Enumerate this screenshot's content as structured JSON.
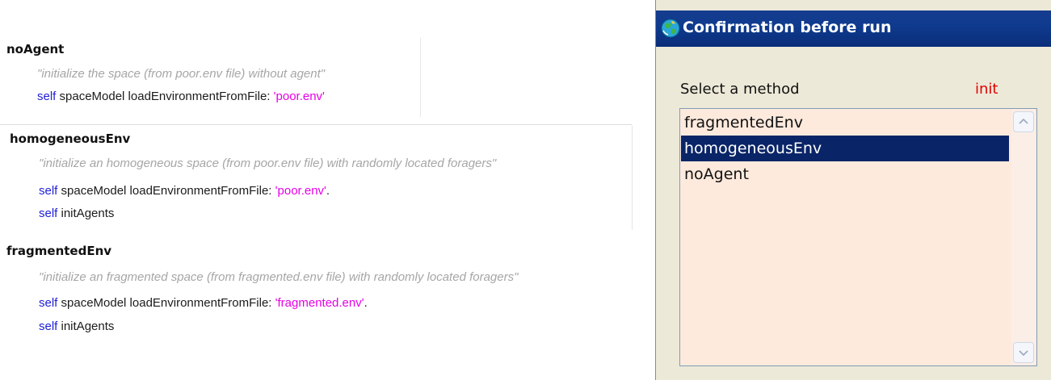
{
  "code_methods": [
    {
      "name": "noAgent",
      "comment": "\"initialize the space (from poor.env file) without agent\"",
      "line1": {
        "kw": "self",
        "text": " spaceModel loadEnvironmentFromFile: ",
        "str": "'poor.env'",
        "tail": ""
      }
    },
    {
      "name": "homogeneousEnv",
      "comment": "\"initialize an homogeneous space (from poor.env file) with randomly located foragers\"",
      "line1": {
        "kw": "self",
        "text": " spaceModel loadEnvironmentFromFile: ",
        "str": "'poor.env'",
        "tail": "."
      },
      "line2": {
        "kw": "self",
        "text": " initAgents"
      }
    },
    {
      "name": "fragmentedEnv",
      "comment": "\"initialize an fragmented space (from fragmented.env file) with randomly located foragers\"",
      "line1": {
        "kw": "self",
        "text": " spaceModel loadEnvironmentFromFile: ",
        "str": "'fragmented.env'",
        "tail": "."
      },
      "line2": {
        "kw": "self",
        "text": " initAgents"
      }
    }
  ],
  "dialog": {
    "title": "Confirmation before run",
    "select_label": "Select a method",
    "init_label": "init",
    "options": [
      "fragmentedEnv",
      "homogeneousEnv",
      "noAgent"
    ],
    "selected": "homogeneousEnv"
  },
  "colors": {
    "titlebar": "#0f3b8f",
    "selection": "#0a2567",
    "listbox_bg": "#fdeadd",
    "keyword": "#1f1fd6",
    "string": "#e600e6",
    "comment": "#a6a6a6",
    "init": "#e00000"
  }
}
